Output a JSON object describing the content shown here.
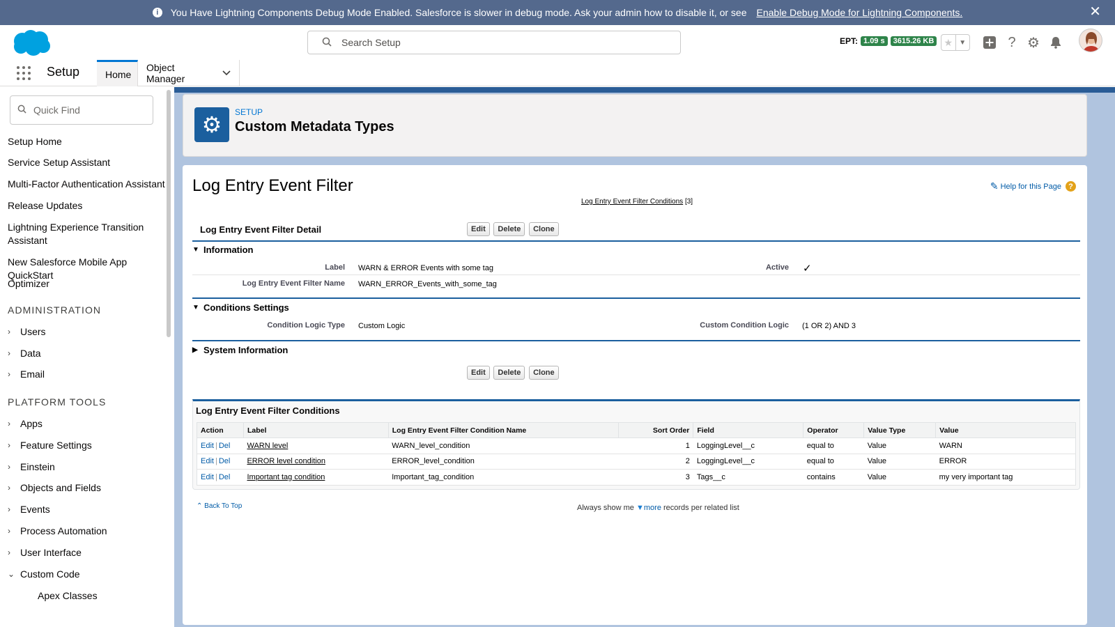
{
  "banner": {
    "message": "You Have Lightning Components Debug Mode Enabled. Salesforce is slower in debug mode. Ask your admin how to disable it, or see",
    "link": "Enable Debug Mode for Lightning Components.",
    "close": "✕"
  },
  "header": {
    "search_placeholder": "Search Setup",
    "ept_label": "EPT:",
    "ept_time": "1.09 s",
    "ept_size": "3615.26 KB"
  },
  "context": {
    "app_name": "Setup",
    "tabs": [
      {
        "label": "Home"
      },
      {
        "label": "Object Manager"
      }
    ]
  },
  "sidebar": {
    "quickfind_placeholder": "Quick Find",
    "items": [
      {
        "label": "Setup Home"
      },
      {
        "label": "Service Setup Assistant"
      },
      {
        "label": "Multi-Factor Authentication Assistant"
      },
      {
        "label": "Release Updates"
      },
      {
        "label": "Lightning Experience Transition Assistant"
      },
      {
        "label": "New Salesforce Mobile App QuickStart"
      },
      {
        "label": "Optimizer"
      }
    ],
    "admin_heading": "ADMINISTRATION",
    "admin_items": [
      {
        "label": "Users"
      },
      {
        "label": "Data"
      },
      {
        "label": "Email"
      }
    ],
    "platform_heading": "PLATFORM TOOLS",
    "platform_items": [
      {
        "label": "Apps"
      },
      {
        "label": "Feature Settings"
      },
      {
        "label": "Einstein"
      },
      {
        "label": "Objects and Fields"
      },
      {
        "label": "Events"
      },
      {
        "label": "Process Automation"
      },
      {
        "label": "User Interface"
      },
      {
        "label": "Custom Code"
      }
    ],
    "sub_items": [
      {
        "label": "Apex Classes"
      }
    ]
  },
  "page": {
    "eyebrow": "SETUP",
    "title": "Custom Metadata Types"
  },
  "record": {
    "title": "Log Entry Event Filter",
    "help_link": "Help for this Page",
    "related_link": "Log Entry Event Filter Conditions",
    "related_count": "[3]",
    "detail_title": "Log Entry Event Filter Detail",
    "buttons": {
      "edit": "Edit",
      "delete": "Delete",
      "clone": "Clone"
    },
    "information": {
      "heading": "Information",
      "label_label": "Label",
      "label_value": "WARN & ERROR Events with some tag",
      "active_label": "Active",
      "active_value": "✓",
      "name_label": "Log Entry Event Filter Name",
      "name_value": "WARN_ERROR_Events_with_some_tag"
    },
    "conditions": {
      "heading": "Conditions Settings",
      "logic_type_label": "Condition Logic Type",
      "logic_type_value": "Custom Logic",
      "custom_logic_label": "Custom Condition Logic",
      "custom_logic_value": "(1 OR 2) AND 3"
    },
    "system": {
      "heading": "System Information"
    }
  },
  "related": {
    "title": "Log Entry Event Filter Conditions",
    "columns": [
      "Action",
      "Label",
      "Log Entry Event Filter Condition Name",
      "Sort Order",
      "Field",
      "Operator",
      "Value Type",
      "Value"
    ],
    "edit": "Edit",
    "del": "Del",
    "rows": [
      {
        "label": "WARN level",
        "name": "WARN_level_condition",
        "sort": "1",
        "field": "LoggingLevel__c",
        "operator": "equal to",
        "value_type": "Value",
        "value": "WARN"
      },
      {
        "label": "ERROR level condition",
        "name": "ERROR_level_condition",
        "sort": "2",
        "field": "LoggingLevel__c",
        "operator": "equal to",
        "value_type": "Value",
        "value": "ERROR"
      },
      {
        "label": "Important tag condition",
        "name": "Important_tag_condition",
        "sort": "3",
        "field": "Tags__c",
        "operator": "contains",
        "value_type": "Value",
        "value": "my very important tag"
      }
    ]
  },
  "footer": {
    "back_to_top": "Back To Top",
    "always_show": "Always show me",
    "more": "more",
    "per_list": "records per related list"
  },
  "colors": {
    "banner": "#54698d",
    "brand_blue": "#0176d3",
    "ept_green": "#2e844a",
    "section_blue": "#1b5f9e"
  }
}
